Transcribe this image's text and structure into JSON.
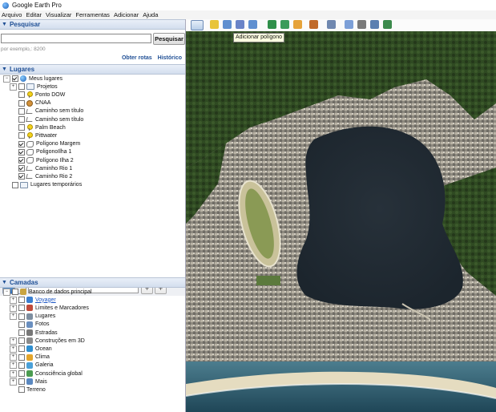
{
  "window": {
    "title": "Google Earth Pro"
  },
  "menu": [
    "Arquivo",
    "Editar",
    "Visualizar",
    "Ferramentas",
    "Adicionar",
    "Ajuda"
  ],
  "search": {
    "header": "Pesquisar",
    "button": "Pesquisar",
    "hint": "por exemplo,: 8200",
    "link_routes": "Obter rotas",
    "link_history": "Histórico"
  },
  "places": {
    "header": "Lugares",
    "items": [
      {
        "label": "Meus lugares",
        "icon": "globe-icon",
        "checked": true,
        "indent": 0,
        "expander": "−"
      },
      {
        "label": "Projetos",
        "icon": "folder-icon",
        "checked": false,
        "indent": 1,
        "expander": "+"
      },
      {
        "label": "Ponto DOW",
        "icon": "pushpin-icon",
        "checked": false,
        "indent": 1
      },
      {
        "label": "CNAA",
        "icon": "dot-icon",
        "checked": false,
        "indent": 1
      },
      {
        "label": "Caminho sem título",
        "icon": "path-icon",
        "checked": false,
        "indent": 1
      },
      {
        "label": "Caminho sem título",
        "icon": "path-icon",
        "checked": false,
        "indent": 1
      },
      {
        "label": "Palm Beach",
        "icon": "pushpin-icon",
        "checked": false,
        "indent": 1
      },
      {
        "label": "Pittwater",
        "icon": "pushpin-icon",
        "checked": false,
        "indent": 1
      },
      {
        "label": "Polígono Margem",
        "icon": "polygon-icon",
        "checked": true,
        "indent": 1
      },
      {
        "label": "PoligonoIlha 1",
        "icon": "polygon-icon",
        "checked": true,
        "indent": 1
      },
      {
        "label": "Polígono Ilha 2",
        "icon": "polygon-icon",
        "checked": true,
        "indent": 1
      },
      {
        "label": "Caminho Rio 1",
        "icon": "path-icon",
        "checked": true,
        "indent": 1
      },
      {
        "label": "Caminho Rio 2",
        "icon": "path-icon",
        "checked": true,
        "indent": 1
      },
      {
        "label": "Lugares temporários",
        "icon": "folder-icon",
        "checked": false,
        "indent": 0
      }
    ]
  },
  "layers": {
    "header": "Camadas",
    "items": [
      {
        "label": "Banco de dados principal",
        "icon": "database-icon",
        "indent": 0,
        "expander": "−",
        "link": false
      },
      {
        "label": "Voyager",
        "icon": "voyager-icon",
        "indent": 1,
        "expander": "+",
        "link": true
      },
      {
        "label": "Limites e Marcadores",
        "icon": "borders-icon",
        "indent": 1,
        "expander": "+",
        "link": false
      },
      {
        "label": "Lugares",
        "icon": "places-layer-icon",
        "indent": 1,
        "expander": "+",
        "link": false
      },
      {
        "label": "Fotos",
        "icon": "photo-icon",
        "indent": 1,
        "expander": "",
        "link": false
      },
      {
        "label": "Estradas",
        "icon": "roads-icon",
        "indent": 1,
        "expander": "",
        "link": false
      },
      {
        "label": "Construções em 3D",
        "icon": "buildings-icon",
        "indent": 1,
        "expander": "+",
        "link": false
      },
      {
        "label": "Ocean",
        "icon": "ocean-icon",
        "indent": 1,
        "expander": "+",
        "link": false
      },
      {
        "label": "Clima",
        "icon": "weather-icon",
        "indent": 1,
        "expander": "+",
        "link": false
      },
      {
        "label": "Galeria",
        "icon": "gallery-icon",
        "indent": 1,
        "expander": "+",
        "link": false
      },
      {
        "label": "Consciência global",
        "icon": "awareness-icon",
        "indent": 1,
        "expander": "+",
        "link": false
      },
      {
        "label": "Mais",
        "icon": "more-icon",
        "indent": 1,
        "expander": "+",
        "link": false
      },
      {
        "label": "Terreno",
        "icon": "",
        "indent": 1,
        "expander": "",
        "link": false
      }
    ]
  },
  "toolbar": {
    "tooltip": "Adicionar polígono",
    "buttons": [
      "sidebar-toggle-icon",
      "placemark-icon",
      "polygon-icon",
      "path-icon",
      "overlay-icon",
      "tour-icon",
      "historical-imagery-icon",
      "sun-icon",
      "planet-icon",
      "ruler-icon",
      "email-icon",
      "print-icon",
      "save-image-icon",
      "maps-icon"
    ]
  }
}
